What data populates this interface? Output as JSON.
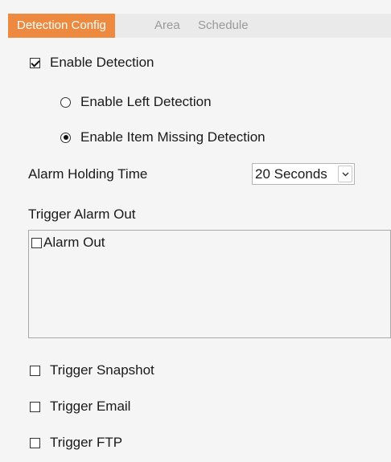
{
  "tabs": [
    {
      "label": "Detection Config",
      "active": true
    },
    {
      "label": "Area",
      "active": false
    },
    {
      "label": "Schedule",
      "active": false
    }
  ],
  "enable_detection": {
    "label": "Enable Detection",
    "checked": true
  },
  "detection_mode": {
    "options": [
      {
        "label": "Enable Left Detection",
        "selected": false
      },
      {
        "label": "Enable Item Missing Detection",
        "selected": true
      }
    ]
  },
  "alarm_holding": {
    "label": "Alarm Holding Time",
    "value": "20 Seconds"
  },
  "trigger_alarm_out": {
    "label": "Trigger Alarm Out",
    "items": [
      {
        "label": "Alarm Out",
        "checked": false
      }
    ]
  },
  "triggers": [
    {
      "label": "Trigger Snapshot",
      "checked": false
    },
    {
      "label": "Trigger Email",
      "checked": false
    },
    {
      "label": "Trigger FTP",
      "checked": false
    }
  ],
  "colors": {
    "accent": "#ed8a3f",
    "tab_inactive_text": "#9a9a9a",
    "background": "#f5f5f5"
  },
  "icons": {
    "dropdown": "chevron-down-icon"
  }
}
